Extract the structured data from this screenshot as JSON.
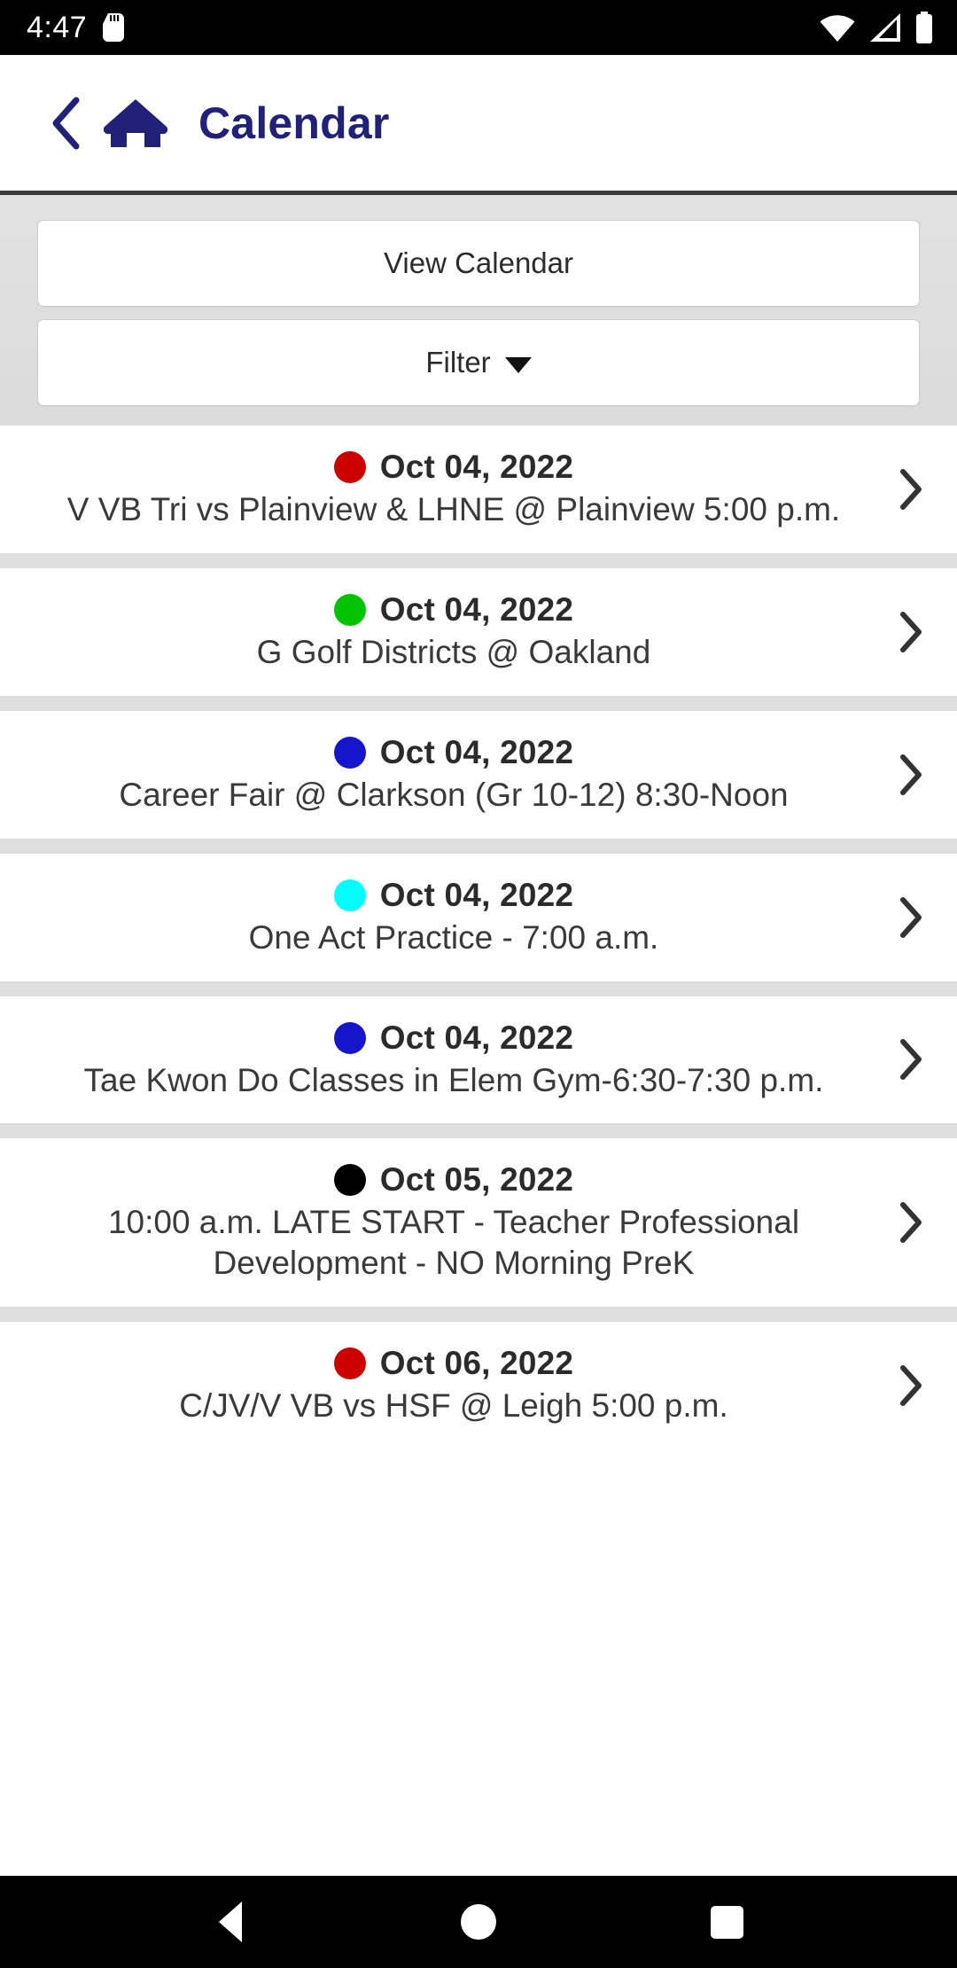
{
  "status_bar": {
    "time": "4:47",
    "left_icons": [
      "sd-card-icon"
    ],
    "right_icons": [
      "wifi-icon",
      "cell-signal-icon",
      "battery-icon"
    ]
  },
  "header": {
    "back_icon": "chevron-left-icon",
    "home_icon": "home-icon",
    "title": "Calendar",
    "title_color": "#22217a"
  },
  "toolbar": {
    "view_calendar_label": "View Calendar",
    "filter_label": "Filter",
    "filter_caret_icon": "caret-down-icon"
  },
  "events": [
    {
      "dot_color": "#cc0000",
      "date": "Oct 04, 2022",
      "title": "V VB Tri vs Plainview & LHNE @ Plainview 5:00 p.m.",
      "chevron_icon": "chevron-right-icon"
    },
    {
      "dot_color": "#00c400",
      "date": "Oct 04, 2022",
      "title": "G Golf Districts @ Oakland",
      "chevron_icon": "chevron-right-icon"
    },
    {
      "dot_color": "#1515cc",
      "date": "Oct 04, 2022",
      "title": "Career Fair @ Clarkson (Gr 10-12) 8:30-Noon",
      "chevron_icon": "chevron-right-icon"
    },
    {
      "dot_color": "#00ffff",
      "date": "Oct 04, 2022",
      "title": "One Act Practice - 7:00 a.m.",
      "chevron_icon": "chevron-right-icon"
    },
    {
      "dot_color": "#1515cc",
      "date": "Oct 04, 2022",
      "title": "Tae Kwon Do Classes in Elem Gym-6:30-7:30 p.m.",
      "chevron_icon": "chevron-right-icon"
    },
    {
      "dot_color": "#000000",
      "date": "Oct 05, 2022",
      "title": "10:00 a.m. LATE START - Teacher Professional Development - NO Morning PreK",
      "chevron_icon": "chevron-right-icon"
    },
    {
      "dot_color": "#cc0000",
      "date": "Oct 06, 2022",
      "title": "C/JV/V VB vs HSF @ Leigh 5:00 p.m.",
      "chevron_icon": "chevron-right-icon"
    }
  ],
  "nav_bar": {
    "back_icon": "triangle-back-icon",
    "home_icon": "circle-home-icon",
    "recents_icon": "square-recents-icon"
  }
}
